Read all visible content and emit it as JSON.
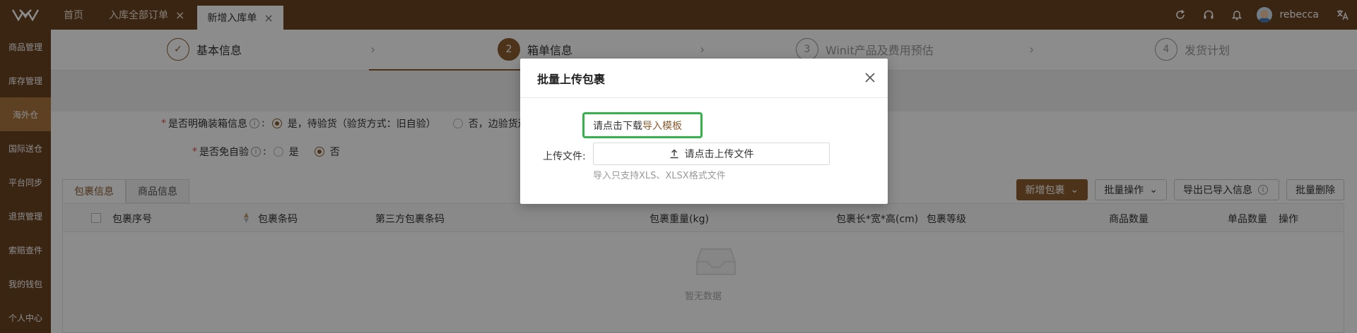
{
  "topbar": {
    "tabs": [
      {
        "label": "首页"
      },
      {
        "label": "入库全部订单"
      },
      {
        "label": "新增入库单"
      }
    ],
    "user": "rebecca"
  },
  "sidebar": {
    "items": [
      {
        "label": "商品管理"
      },
      {
        "label": "库存管理"
      },
      {
        "label": "海外仓"
      },
      {
        "label": "国际送仓"
      },
      {
        "label": "平台同步"
      },
      {
        "label": "退货管理"
      },
      {
        "label": "索赔查件"
      },
      {
        "label": "我的钱包"
      },
      {
        "label": "个人中心"
      }
    ]
  },
  "steps": [
    {
      "num": "✓",
      "label": "基本信息"
    },
    {
      "num": "2",
      "label": "箱单信息"
    },
    {
      "num": "3",
      "label": "Winit产品及费用预估"
    },
    {
      "num": "4",
      "label": "发货计划"
    }
  ],
  "form": {
    "q1": {
      "label": "是否明确装箱信息",
      "opt1": "是，待验货（验货方式：旧自验）",
      "opt2": "否，边验货边"
    },
    "q2": {
      "label": "是否免自验",
      "opt1": "是",
      "opt2": "否"
    }
  },
  "panel_tabs": [
    "包裹信息",
    "商品信息"
  ],
  "buttons": {
    "add": "新增包裹",
    "batch": "批量操作",
    "export": "导出已导入信息",
    "batch_delete": "批量删除"
  },
  "table": {
    "headers": [
      "包裹序号",
      "包裹条码",
      "第三方包裹条码",
      "包裹重量(kg)",
      "包裹长*宽*高(cm)",
      "包裹等级",
      "商品数量",
      "单品数量",
      "操作"
    ],
    "empty": "暂无数据"
  },
  "modal": {
    "title": "批量上传包裹",
    "download_prefix": "请点击下载",
    "download_link": "导入模板",
    "upload_label": "上传文件:",
    "upload_button": "请点击上传文件",
    "upload_hint": "导入只支持XLS、XLSX格式文件"
  }
}
